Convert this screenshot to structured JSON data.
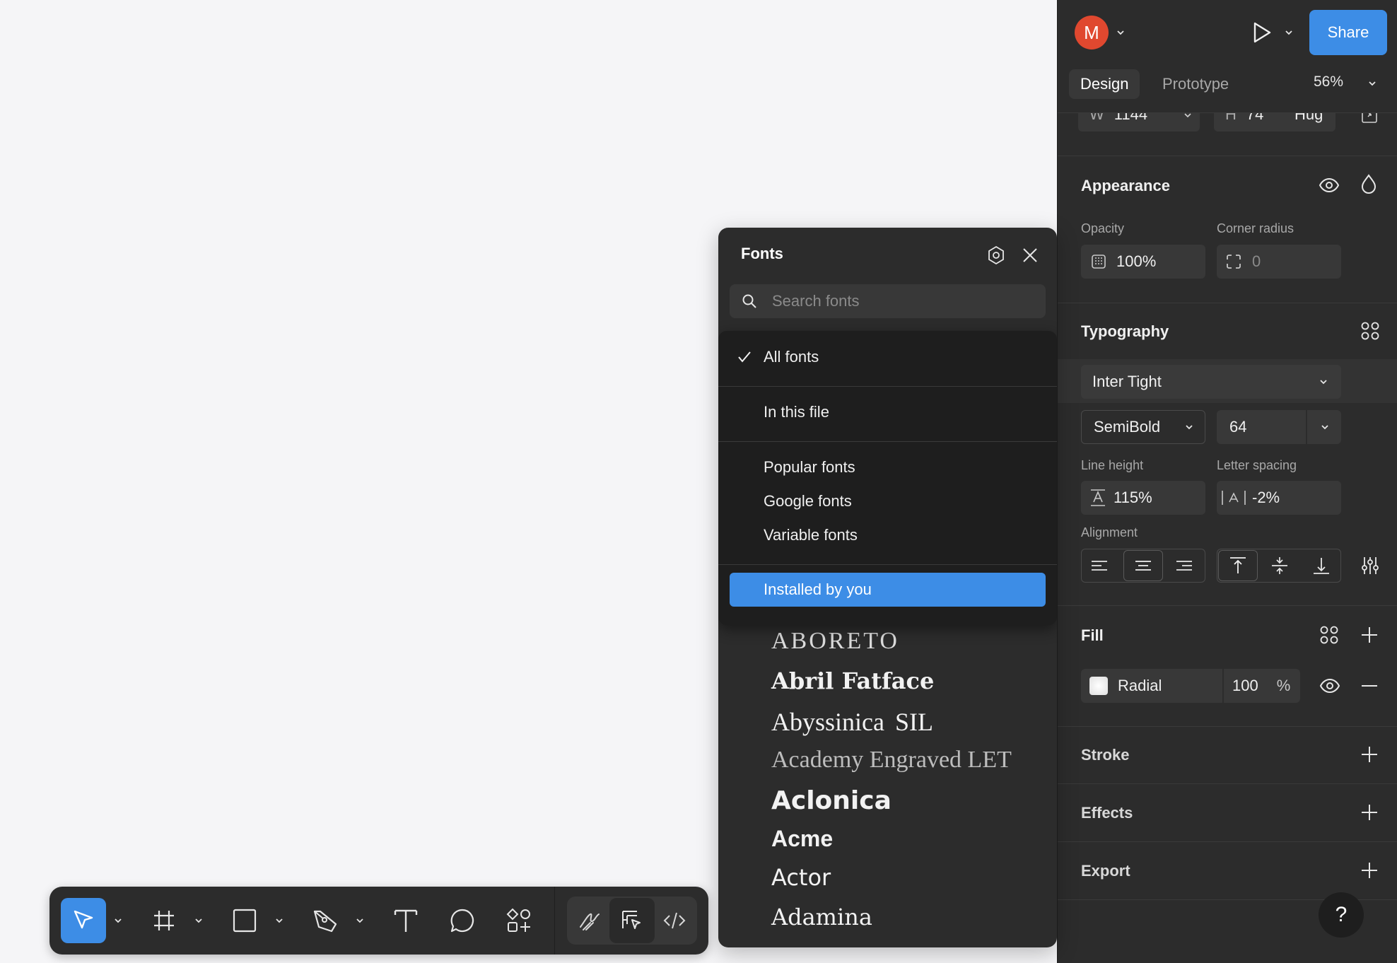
{
  "header": {
    "avatar_initial": "M",
    "share_label": "Share",
    "tabs": [
      {
        "label": "Design",
        "active": true
      },
      {
        "label": "Prototype",
        "active": false
      }
    ],
    "zoom": "56%"
  },
  "dimensions": {
    "w_label": "W",
    "w_value": "1144",
    "h_label": "H",
    "h_value": "74",
    "h_mode": "Hug"
  },
  "appearance": {
    "title": "Appearance",
    "opacity_label": "Opacity",
    "opacity_value": "100%",
    "corner_label": "Corner radius",
    "corner_value": "0"
  },
  "typography": {
    "title": "Typography",
    "font_family": "Inter Tight",
    "font_weight": "SemiBold",
    "font_size": "64",
    "line_height_label": "Line height",
    "line_height_value": "115%",
    "letter_spacing_label": "Letter spacing",
    "letter_spacing_value": "-2%",
    "alignment_label": "Alignment"
  },
  "fill": {
    "title": "Fill",
    "type": "Radial",
    "opacity": "100",
    "unit": "%"
  },
  "sections": {
    "stroke": "Stroke",
    "effects": "Effects",
    "export": "Export"
  },
  "fonts_popup": {
    "title": "Fonts",
    "search_placeholder": "Search fonts",
    "filter_menu": {
      "checked": "All fonts",
      "in_file": "In this file",
      "popular": "Popular fonts",
      "google": "Google fonts",
      "variable": "Variable fonts",
      "installed": "Installed by you"
    },
    "font_list": [
      "ABORETO",
      "Abril Fatface",
      "Abyssinica SIL",
      "Academy Engraved LET",
      "Aclonica",
      "Acme",
      "Actor",
      "Adamina"
    ]
  },
  "help_label": "?",
  "colors": {
    "accent": "#3d8de6",
    "panel_bg": "#2c2c2c",
    "avatar": "#e0482f",
    "canvas": "#f5f5f7"
  }
}
